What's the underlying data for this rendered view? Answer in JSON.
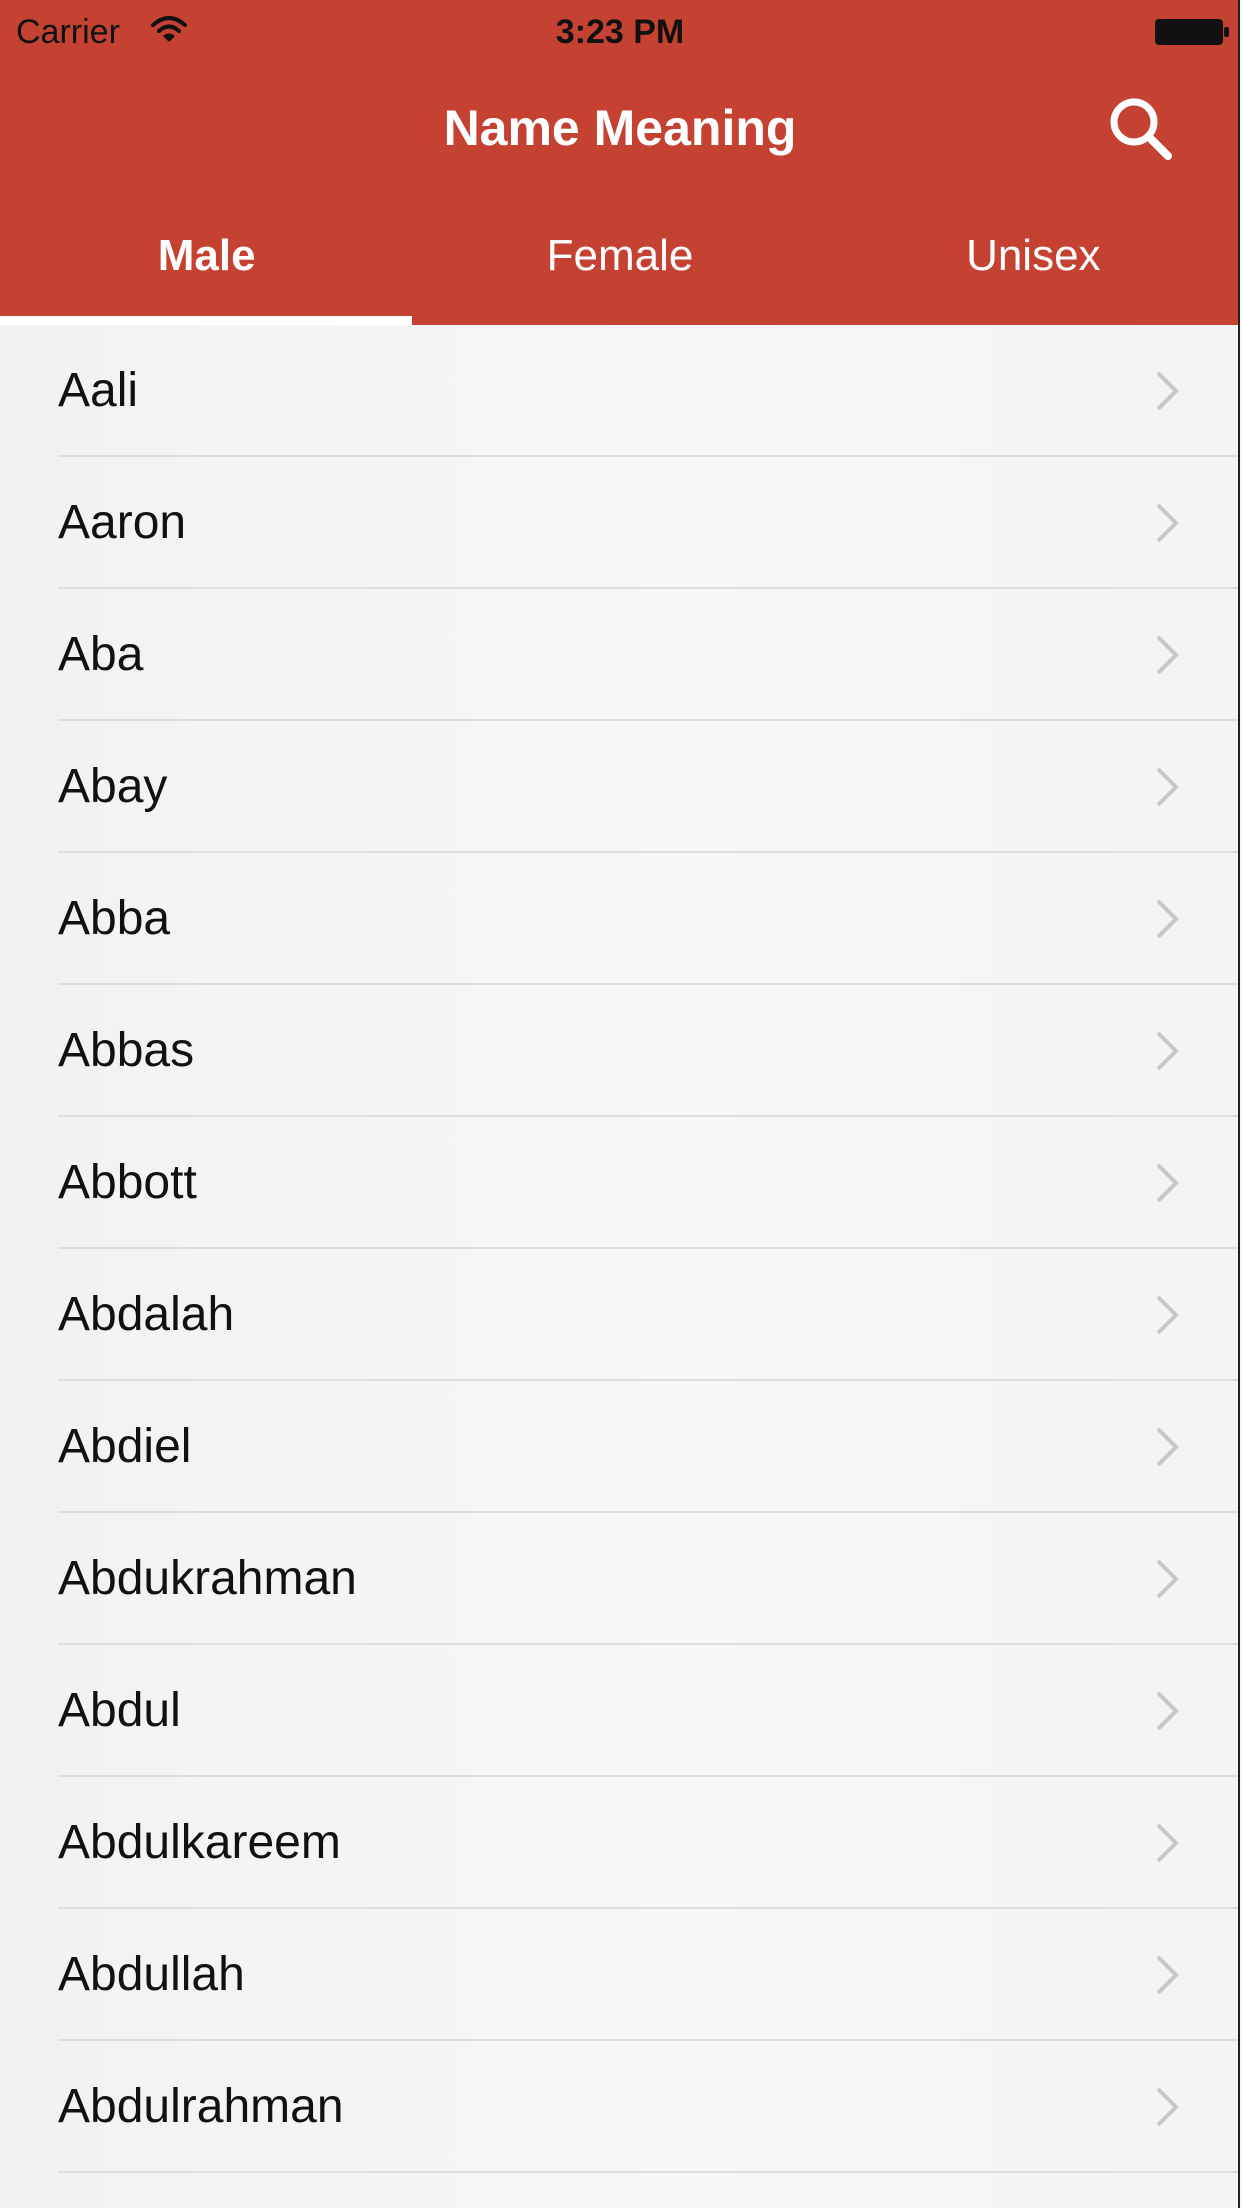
{
  "status_bar": {
    "carrier": "Carrier",
    "time": "3:23 PM",
    "wifi_icon": "wifi-icon",
    "battery_icon": "battery-full-icon"
  },
  "nav": {
    "title": "Name Meaning",
    "search_icon": "search-icon"
  },
  "colors": {
    "brand": "#c54232",
    "tab_indicator": "#ffffff",
    "chevron": "#c7c7cc"
  },
  "tabs": [
    {
      "label": "Male",
      "active": true
    },
    {
      "label": "Female",
      "active": false
    },
    {
      "label": "Unisex",
      "active": false
    }
  ],
  "names": [
    "Aali",
    "Aaron",
    "Aba",
    "Abay",
    "Abba",
    "Abbas",
    "Abbott",
    "Abdalah",
    "Abdiel",
    "Abdukrahman",
    "Abdul",
    "Abdulkareem",
    "Abdullah",
    "Abdulrahman"
  ]
}
